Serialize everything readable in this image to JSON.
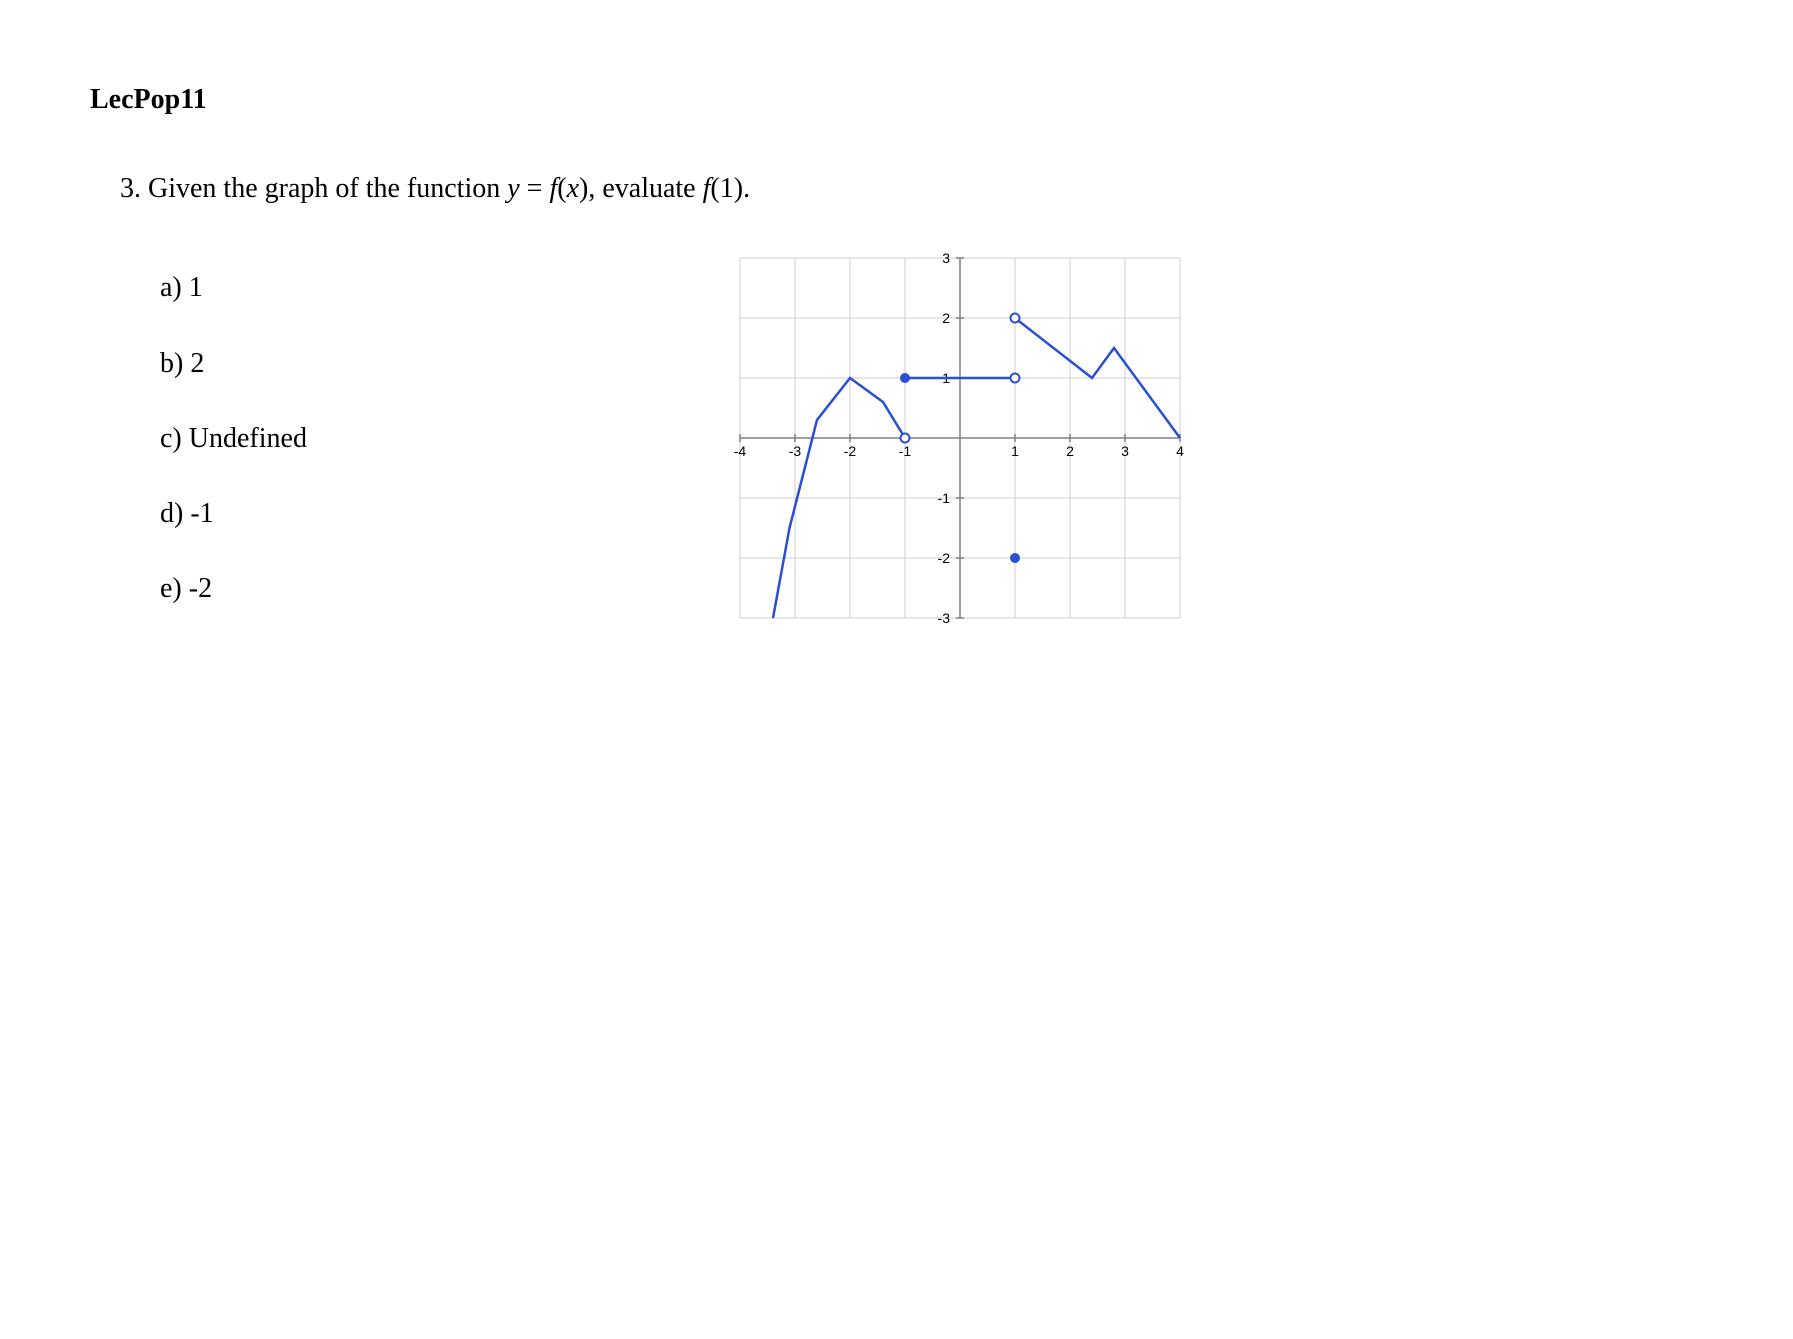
{
  "title": "LecPop11",
  "question": {
    "number": "3.",
    "prefix": "Given the graph of the function ",
    "eq_lhs_var": "y",
    "eq_eq": " = ",
    "eq_rhs_f": "f",
    "eq_rhs_paren_l": "(",
    "eq_rhs_x": "x",
    "eq_rhs_paren_r": ")",
    "middle": ", evaluate ",
    "eval_f": "f",
    "eval_paren_l": "(",
    "eval_arg": "1",
    "eval_paren_r": ")",
    "period": "."
  },
  "answers": [
    {
      "label": "a)",
      "value": "1"
    },
    {
      "label": "b)",
      "value": "2"
    },
    {
      "label": "c)",
      "value": "Undefined"
    },
    {
      "label": "d)",
      "value": "-1"
    },
    {
      "label": "e)",
      "value": "-2"
    }
  ],
  "chart_data": {
    "type": "line",
    "xlim": [
      -4,
      4
    ],
    "ylim": [
      -3,
      3
    ],
    "x_ticks": [
      -4,
      -3,
      -2,
      -1,
      1,
      2,
      3,
      4
    ],
    "y_ticks": [
      -3,
      -2,
      -1,
      1,
      2,
      3
    ],
    "segments": [
      {
        "kind": "parabola",
        "description": "Downward parabola rising from bottom-left, peak near (-2, 1), approaching (-1, 0) open",
        "approx_points": [
          [
            -3.4,
            -3
          ],
          [
            -3.1,
            -1.5
          ],
          [
            -2.6,
            0.3
          ],
          [
            -2,
            1
          ],
          [
            -1.4,
            0.6
          ],
          [
            -1,
            0
          ]
        ],
        "left_end": "arrow_down",
        "right_end": {
          "x": -1,
          "y": 0,
          "type": "open"
        }
      },
      {
        "kind": "horizontal",
        "description": "Horizontal segment at y=1, closed at x=-1, open at x=1",
        "start": {
          "x": -1,
          "y": 1,
          "type": "closed"
        },
        "end": {
          "x": 1,
          "y": 1,
          "type": "open"
        }
      },
      {
        "kind": "isolated_point",
        "x": 1,
        "y": -2,
        "type": "closed"
      },
      {
        "kind": "polyline",
        "description": "Piecewise line starting open at (1,2), down to a local min around (2.5,1), small peak around (2.8,1.4), then descends to (4,0) with arrow",
        "start": {
          "x": 1,
          "y": 2,
          "type": "open"
        },
        "approx_points": [
          [
            1,
            2
          ],
          [
            2.4,
            1
          ],
          [
            2.8,
            1.5
          ],
          [
            4,
            0
          ]
        ],
        "right_end": "arrow"
      }
    ]
  }
}
